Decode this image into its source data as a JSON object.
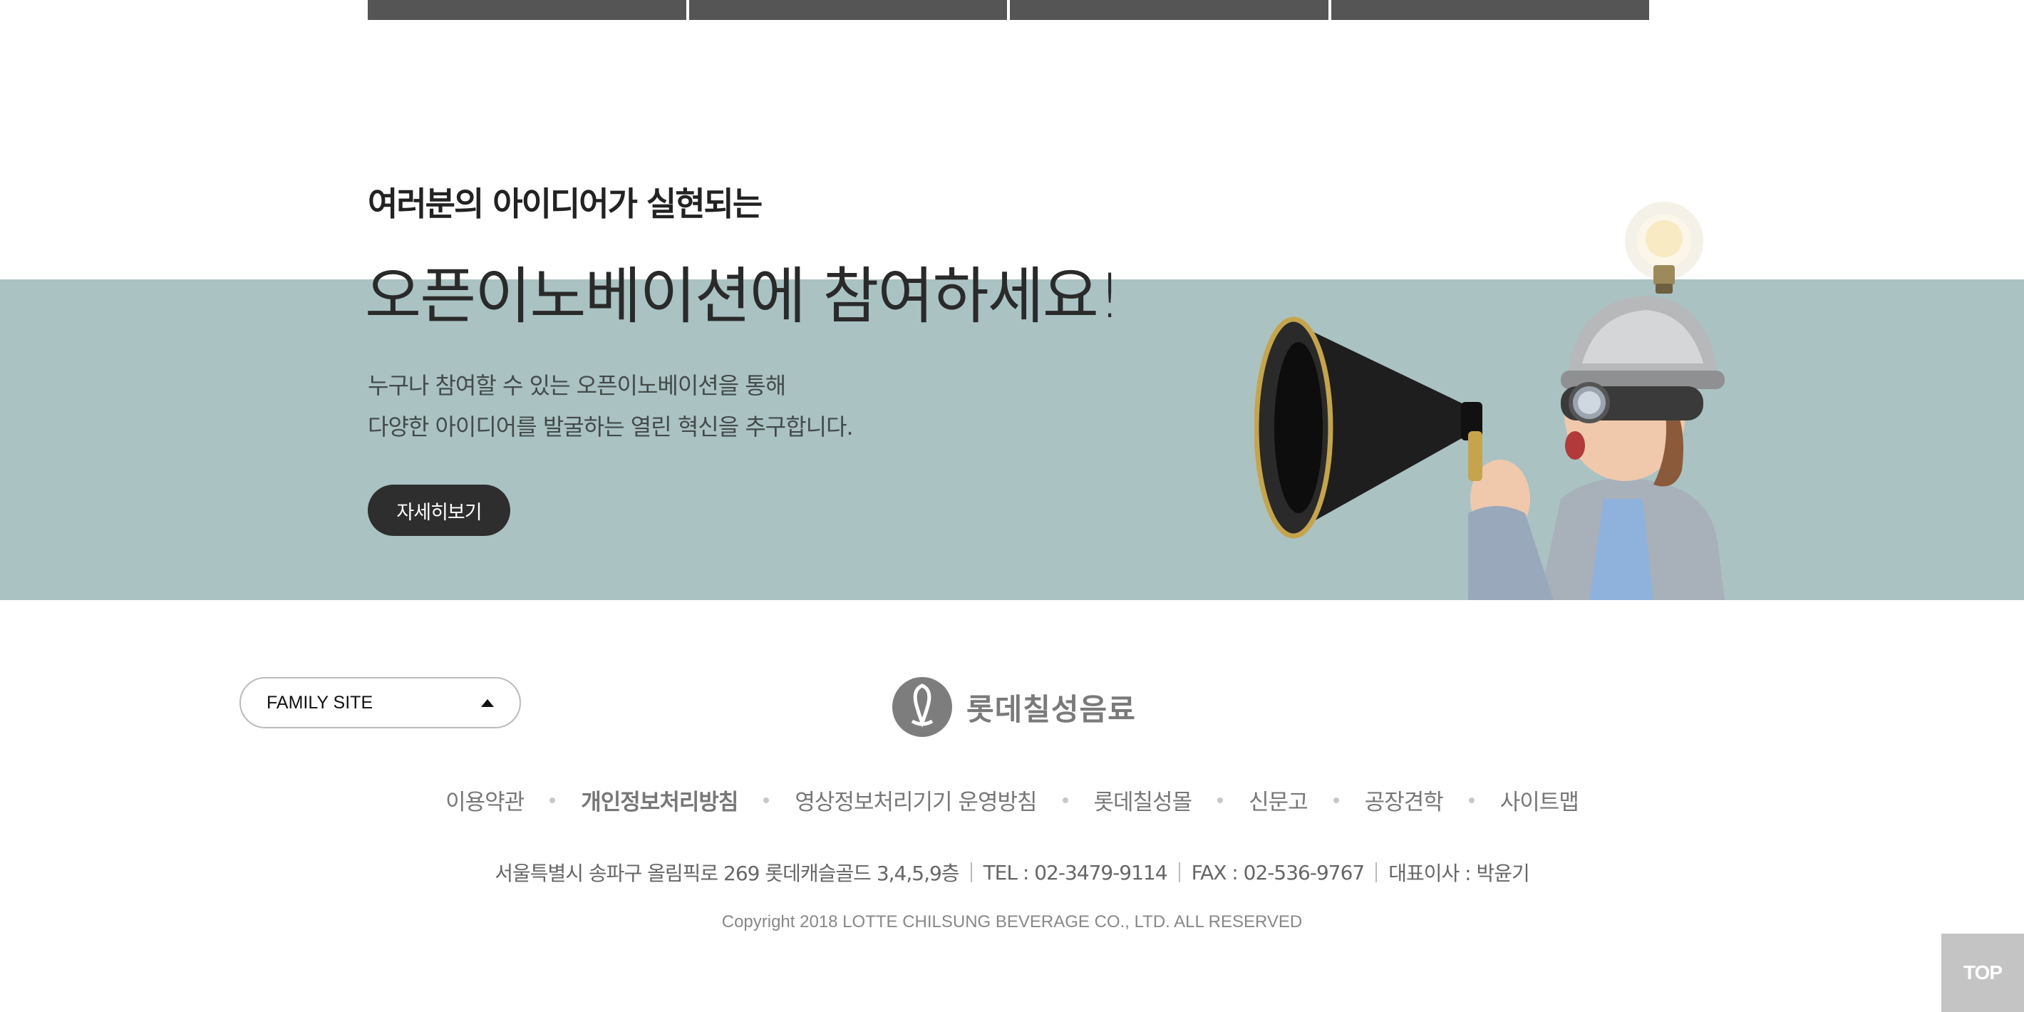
{
  "banner": {
    "subtitle": "여러분의 아이디어가 실현되는",
    "title": "오픈이노베이션에 참여하세요!",
    "desc_line1": "누구나 참여할 수 있는 오픈이노베이션을 통해",
    "desc_line2": "다양한 아이디어를 발굴하는 열린 혁신을 추구합니다.",
    "button_label": "자세히보기",
    "band_color": "#aac3c2"
  },
  "footer": {
    "family_site_label": "FAMILY SITE",
    "logo_text": "롯데칠성음료",
    "links": [
      {
        "label": "이용약관"
      },
      {
        "label": "개인정보처리방침"
      },
      {
        "label": "영상정보처리기기 운영방침"
      },
      {
        "label": "롯데칠성몰"
      },
      {
        "label": "신문고"
      },
      {
        "label": "공장견학"
      },
      {
        "label": "사이트맵"
      }
    ],
    "address": "서울특별시 송파구 올림픽로 269 롯데캐슬골드 3,4,5,9층",
    "tel": "TEL : 02-3479-9114",
    "fax": "FAX : 02-536-9767",
    "ceo": "대표이사 : 박윤기",
    "copyright": "Copyright 2018 LOTTE CHILSUNG BEVERAGE CO., LTD. ALL RESERVED"
  },
  "top_button_label": "TOP"
}
